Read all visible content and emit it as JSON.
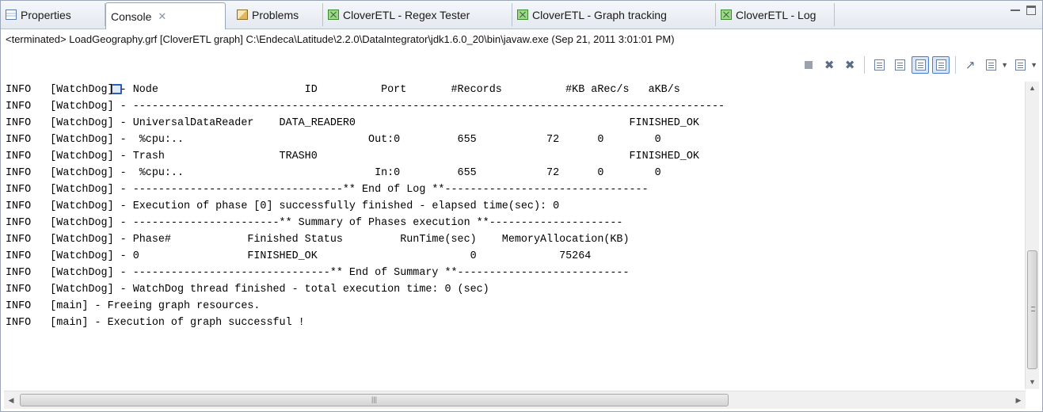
{
  "tabs": [
    {
      "label": "Properties",
      "icon": "properties-icon"
    },
    {
      "label": "Console",
      "icon": "console-icon",
      "active": true
    },
    {
      "label": "Problems",
      "icon": "problems-icon"
    },
    {
      "label": "CloverETL - Regex Tester",
      "icon": "clover-icon"
    },
    {
      "label": "CloverETL - Graph tracking",
      "icon": "clover-icon"
    },
    {
      "label": "CloverETL - Log",
      "icon": "clover-icon"
    }
  ],
  "tab_close_glyph": "✕",
  "status_line": "<terminated> LoadGeography.grf [CloverETL graph] C:\\Endeca\\Latitude\\2.2.0\\DataIntegrator\\jdk1.6.0_20\\bin\\javaw.exe (Sep 21, 2011 3:01:01 PM)",
  "toolbar": {
    "buttons": [
      "terminate-icon",
      "remove-launch-icon",
      "remove-all-terminated-icon",
      "clear-console-icon",
      "scroll-lock-icon",
      "show-console-on-output-icon",
      "show-console-on-error-icon",
      "pin-console-icon",
      "display-selected-console-icon",
      "open-console-icon"
    ]
  },
  "console": {
    "lines": [
      "INFO   [WatchDog] - Node                       ID          Port       #Records          #KB aRec/s   aKB/s",
      "INFO   [WatchDog] - ---------------------------------------------------------------------------------------------",
      "INFO   [WatchDog] - UniversalDataReader    DATA_READER0                                           FINISHED_OK",
      "INFO   [WatchDog] -  %cpu:..                             Out:0         655           72      0        0",
      "INFO   [WatchDog] - Trash                  TRASH0                                                 FINISHED_OK",
      "INFO   [WatchDog] -  %cpu:..                              In:0         655           72      0        0",
      "INFO   [WatchDog] - ---------------------------------** End of Log **--------------------------------",
      "INFO   [WatchDog] - Execution of phase [0] successfully finished - elapsed time(sec): 0",
      "INFO   [WatchDog] - -----------------------** Summary of Phases execution **---------------------",
      "INFO   [WatchDog] - Phase#            Finished Status         RunTime(sec)    MemoryAllocation(KB)",
      "INFO   [WatchDog] - 0                 FINISHED_OK                        0             75264",
      "INFO   [WatchDog] - -------------------------------** End of Summary **---------------------------",
      "INFO   [WatchDog] - WatchDog thread finished - total execution time: 0 (sec)",
      "INFO   [main] - Freeing graph resources.",
      "INFO   [main] - Execution of graph successful !"
    ]
  },
  "colors": {
    "tab_bar": "#e4e9f0",
    "border": "#9aa6b8",
    "console_text": "#000000",
    "pressed_button": "#d8e6fa"
  }
}
